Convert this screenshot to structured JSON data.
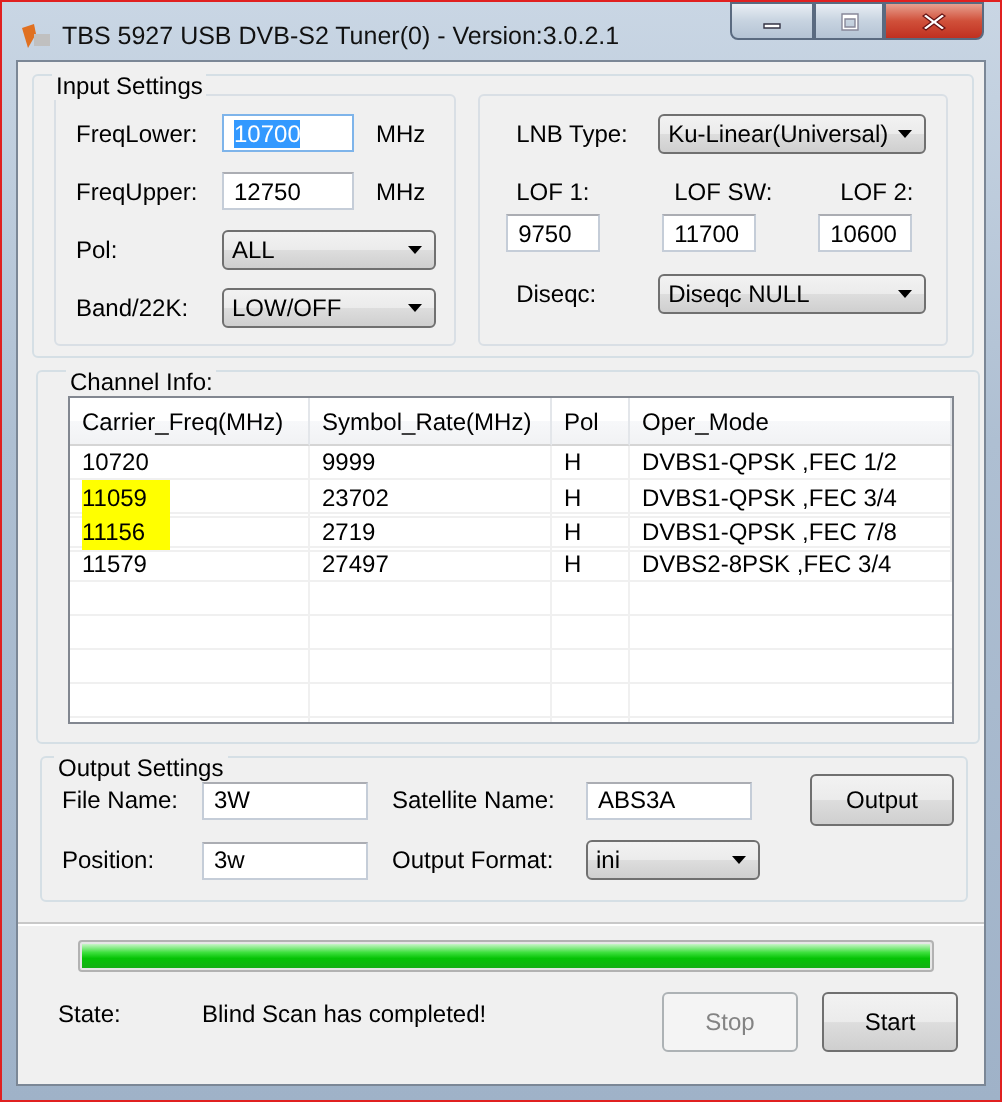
{
  "window": {
    "title": "TBS 5927 USB DVB-S2 Tuner(0) - Version:3.0.2.1"
  },
  "input_settings": {
    "title": "Input Settings",
    "left_rows": [
      {
        "kind": "field",
        "label": "FreqLower:",
        "value": "10700",
        "selected": true,
        "unit": "MHz"
      },
      {
        "kind": "field",
        "label": "FreqUpper:",
        "value": "12750",
        "selected": false,
        "unit": "MHz"
      },
      {
        "kind": "combo",
        "label": "Pol:",
        "value": "ALL"
      },
      {
        "kind": "combo",
        "label": "Band/22K:",
        "value": "LOW/OFF"
      }
    ],
    "lnb_type": {
      "label": "LNB Type:",
      "value": "Ku-Linear(Universal)"
    },
    "lofs": [
      {
        "label": "LOF 1:",
        "value": "9750"
      },
      {
        "label": "LOF SW:",
        "value": "11700"
      },
      {
        "label": "LOF 2:",
        "value": "10600"
      }
    ],
    "diseqc": {
      "label": "Diseqc:",
      "value": "Diseqc NULL"
    }
  },
  "channel_info": {
    "title": "Channel Info:",
    "columns": [
      "Carrier_Freq(MHz)",
      "Symbol_Rate(MHz)",
      "Pol",
      "Oper_Mode"
    ],
    "rows": [
      {
        "cells": [
          "10720",
          "9999",
          "H",
          "DVBS1-QPSK ,FEC 1/2"
        ],
        "highlighted": false
      },
      {
        "cells": [
          "11059",
          "23702",
          "H",
          "DVBS1-QPSK ,FEC 3/4"
        ],
        "highlighted": true
      },
      {
        "cells": [
          "11156",
          "2719",
          "H",
          "DVBS1-QPSK ,FEC 7/8"
        ],
        "highlighted": true
      },
      {
        "cells": [
          "11579",
          "27497",
          "H",
          "DVBS2-8PSK ,FEC 3/4"
        ],
        "highlighted": false
      }
    ]
  },
  "output_settings": {
    "title": "Output Settings",
    "file_name": {
      "label": "File Name:",
      "value": "3W"
    },
    "satellite_name": {
      "label": "Satellite Name:",
      "value": "ABS3A"
    },
    "output_button": "Output",
    "position": {
      "label": "Position:",
      "value": "3w"
    },
    "output_format": {
      "label": "Output Format:",
      "value": "ini"
    }
  },
  "progress": {
    "level": 1
  },
  "state": {
    "label": "State:",
    "text": "Blind Scan has completed!"
  },
  "buttons": [
    {
      "label": "Stop",
      "disabled": true
    },
    {
      "label": "Start",
      "disabled": false
    }
  ]
}
